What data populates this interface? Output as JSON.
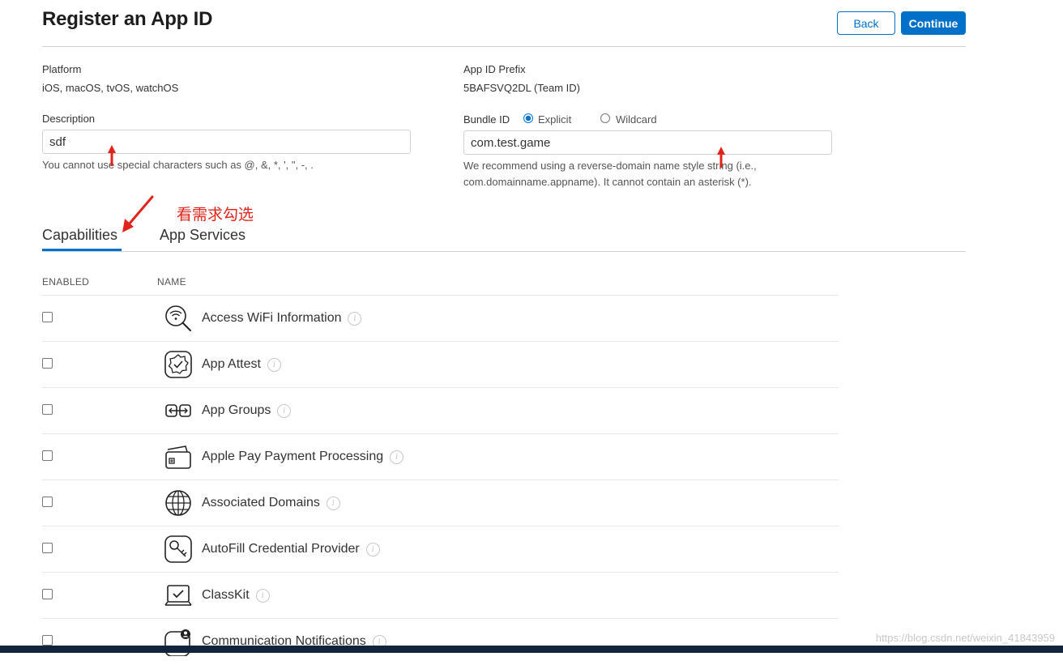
{
  "header": {
    "title": "Register an App ID",
    "back_label": "Back",
    "continue_label": "Continue"
  },
  "platform": {
    "label": "Platform",
    "value": "iOS, macOS, tvOS, watchOS"
  },
  "prefix": {
    "label": "App ID Prefix",
    "value": "5BAFSVQ2DL (Team ID)"
  },
  "description": {
    "label": "Description",
    "value": "sdf",
    "hint": "You cannot use special characters such as @, &, *, ', \", -, ."
  },
  "bundle": {
    "label": "Bundle ID",
    "options": [
      "Explicit",
      "Wildcard"
    ],
    "selected": "Explicit",
    "value": "com.test.game",
    "hint_line1": "We recommend using a reverse-domain name style string (i.e.,",
    "hint_line2": "com.domainname.appname). It cannot contain an asterisk (*)."
  },
  "annotation": {
    "text": "看需求勾选",
    "color": "#e0241b"
  },
  "tabs": [
    "Capabilities",
    "App Services"
  ],
  "active_tab": "Capabilities",
  "table": {
    "headers": [
      "ENABLED",
      "NAME"
    ],
    "rows": [
      {
        "name": "Access WiFi Information",
        "icon": "wifi-search-icon",
        "enabled": false
      },
      {
        "name": "App Attest",
        "icon": "badge-check-icon",
        "enabled": false
      },
      {
        "name": "App Groups",
        "icon": "app-groups-icon",
        "enabled": false
      },
      {
        "name": "Apple Pay Payment Processing",
        "icon": "wallet-card-icon",
        "enabled": false
      },
      {
        "name": "Associated Domains",
        "icon": "globe-icon",
        "enabled": false
      },
      {
        "name": "AutoFill Credential Provider",
        "icon": "key-icon",
        "enabled": false
      },
      {
        "name": "ClassKit",
        "icon": "classkit-icon",
        "enabled": false
      },
      {
        "name": "Communication Notifications",
        "icon": "communication-icon",
        "enabled": false
      }
    ]
  },
  "watermark": "https://blog.csdn.net/weixin_41843959",
  "colors": {
    "accent": "#0070c9",
    "annotation": "#e0241b"
  }
}
